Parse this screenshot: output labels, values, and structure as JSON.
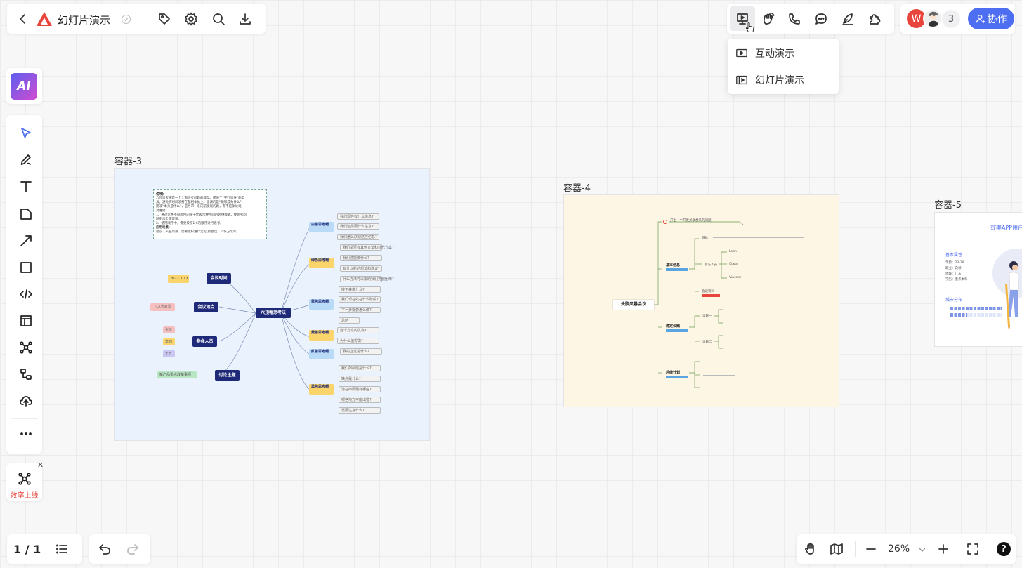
{
  "header": {
    "title": "幻灯片演示",
    "collaborator_count": "3",
    "avatar_letter": "W",
    "collab_label": "协作"
  },
  "present_menu": {
    "items": [
      {
        "label": "互动演示",
        "icon": "present-screen-icon"
      },
      {
        "label": "幻灯片演示",
        "icon": "slides-icon"
      }
    ]
  },
  "left_toolbar": {
    "ai_label": "AI",
    "tools": [
      "select-icon",
      "pen-icon",
      "text-icon",
      "sticky-note-icon",
      "arrow-icon",
      "rectangle-icon",
      "code-icon",
      "layout-icon",
      "mindmap-icon",
      "flowchart-icon",
      "upload-icon",
      "more-icon"
    ]
  },
  "template_card": {
    "label": "效率上线"
  },
  "containers": {
    "c3": {
      "label": "容器-3",
      "note_title": "说明:",
      "note_lines": [
        "六顶思考帽是一个全面思考问题的模型。提供了“平行思维”的工",
        "具。避免将时间浪费在互相争执上。强调的是“能够成为什么”，",
        "而非“本身是什么”，是寻求一条向前发展的路，而不是争论谁",
        "对谁错。",
        "",
        "1、通过六种不同颜色的帽子代表六种不同的思维模式，使思考问",
        "题更加全面客观；",
        "2、使用顺序中，需要按照1-6的顺序进行思考。",
        "",
        "应用场景:",
        "会议、头脑风暴、需要组织进行定论(如会议、工作方案等)"
      ],
      "center": "六顶帽思考法",
      "left_nodes": [
        {
          "label": "会议时间",
          "tag": "2022.X.XX"
        },
        {
          "label": "会议地点",
          "tag": "TLX大会堂"
        },
        {
          "label": "参会人员",
          "tags": [
            "张三",
            "李四",
            "王五"
          ]
        },
        {
          "label": "讨论主题",
          "tag": "新产品重点改革事项"
        }
      ],
      "hats": [
        {
          "label": "白色思考帽",
          "sub": "客观信息",
          "leaves": [
            "我们现在有什么信息?",
            "我们还需要什么信息?",
            "我们怎么获取这些信息?"
          ]
        },
        {
          "label": "绿色思考帽",
          "sub": "新奇的想法/创意",
          "leaves": [
            "我们是否有其他方法和替代方案?",
            "我们还能做什么?",
            "有什么新的想法和建议?",
            "什么方法可以帮助我们克服困难?"
          ]
        },
        {
          "label": "蓝色思考帽",
          "sub": "控制思考过程",
          "leaves": [
            "接下来做什么?",
            "我们现在处在什么阶段?",
            "下一步需要怎么做?",
            "总结"
          ]
        },
        {
          "label": "黄色思考帽",
          "sub": "积极面",
          "leaves": [
            "这个方案的优点?",
            "为什么值得做?"
          ]
        },
        {
          "label": "红色思考帽",
          "sub": "直觉感受",
          "leaves": [
            "我的直觉是什么?"
          ]
        },
        {
          "label": "黑色思考帽",
          "sub": "风险",
          "leaves": [
            "我们的风险是什么?",
            "缺点是什么?",
            "潜在的问题有哪些?",
            "哪些地方可能出错?",
            "需要注意什么?"
          ]
        }
      ]
    },
    "c4": {
      "label": "容器-4",
      "center": "头脑风暴会议",
      "top_note": "开出一个开发关联想法的问题",
      "branches": [
        "基本信息",
        "确定议题",
        "后续计划"
      ],
      "sub_labels": [
        "目标",
        "参与人员",
        "会议资料",
        "议题一",
        "议题二"
      ],
      "names": [
        "Leah",
        "Clara",
        "Vincent"
      ]
    },
    "c5": {
      "label": "容器-5",
      "title": "效率APP用户",
      "section1": "基本属性",
      "attrs": [
        "年龄：23-28",
        "职业：白领",
        "地域：广东",
        "学历：重点本科"
      ],
      "section2": "城市分布"
    }
  },
  "bottom": {
    "page": "1 / 1",
    "zoom": "26%"
  }
}
